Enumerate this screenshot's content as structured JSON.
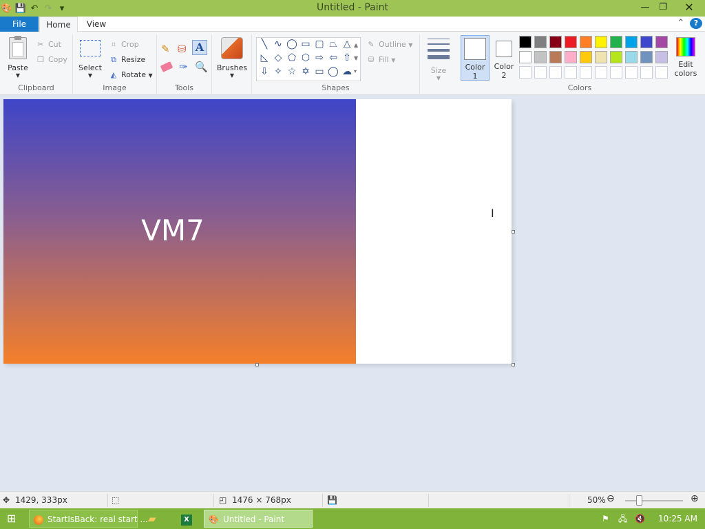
{
  "window": {
    "title": "Untitled - Paint",
    "controls": {
      "minimize": "—",
      "restore": "❐",
      "close": "✕"
    },
    "quick_access": [
      "paint-app-icon",
      "save-icon",
      "undo-icon",
      "redo-icon",
      "customize-icon"
    ]
  },
  "tabs": {
    "file": "File",
    "home": "Home",
    "view": "View"
  },
  "ribbon": {
    "clipboard": {
      "label": "Clipboard",
      "paste": "Paste",
      "cut": "Cut",
      "copy": "Copy"
    },
    "image": {
      "label": "Image",
      "select": "Select",
      "crop": "Crop",
      "resize": "Resize",
      "rotate": "Rotate"
    },
    "tools": {
      "label": "Tools"
    },
    "brushes": {
      "label": "Brushes"
    },
    "shapes": {
      "label": "Shapes",
      "outline": "Outline",
      "fill": "Fill"
    },
    "size": {
      "label": "Size"
    },
    "colors": {
      "label": "Colors",
      "color1": "Color",
      "color1_num": "1",
      "color2": "Color",
      "color2_num": "2",
      "edit": "Edit",
      "edit2": "colors",
      "row1": [
        "#000000",
        "#7f7f7f",
        "#880015",
        "#ed1c24",
        "#ff7f27",
        "#fff200",
        "#22b14c",
        "#00a2e8",
        "#3f48cc",
        "#a349a4"
      ],
      "row2": [
        "#ffffff",
        "#c3c3c3",
        "#b97a57",
        "#ffaec9",
        "#ffc90e",
        "#efe4b0",
        "#b5e61d",
        "#99d9ea",
        "#7092be",
        "#c8bfe7"
      ]
    }
  },
  "canvas": {
    "text": "VM7",
    "gradient_top": "#3e45c8",
    "gradient_bottom": "#f47f2a"
  },
  "status": {
    "cursor_pos": "1429, 333px",
    "image_size": "1476 × 768px",
    "zoom": "50%"
  },
  "taskbar": {
    "startisback": "StartIsBack: real start ...",
    "paint": "Untitled - Paint",
    "time": "10:25 AM"
  }
}
